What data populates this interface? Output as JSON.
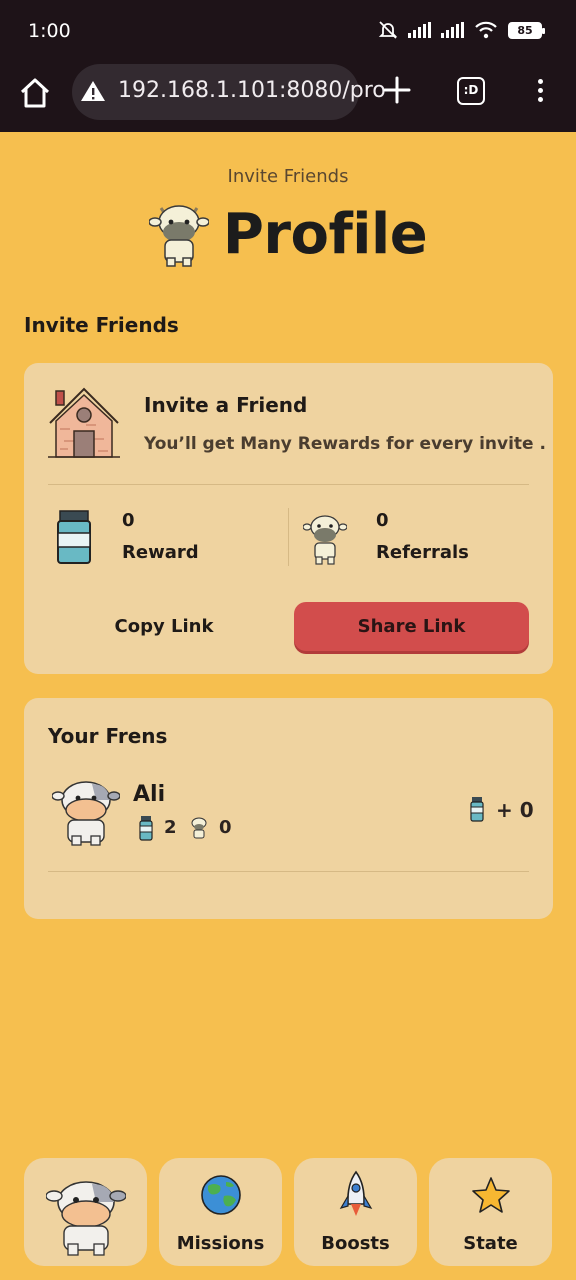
{
  "status_bar": {
    "time": "1:00",
    "battery": "85"
  },
  "browser": {
    "url": "192.168.1.101:8080/pro",
    "tabs_label": ":D"
  },
  "header": {
    "subtitle": "Invite Friends",
    "title": "Profile"
  },
  "section_heading": "Invite Friends",
  "invite": {
    "title": "Invite a Friend",
    "description": "You’ll get Many Rewards for every invite .",
    "reward_value": "0",
    "reward_label": "Reward",
    "referrals_value": "0",
    "referrals_label": "Referrals",
    "copy_label": "Copy Link",
    "share_label": "Share Link"
  },
  "frens": {
    "title": "Your Frens",
    "items": [
      {
        "name": "Ali",
        "milk": "2",
        "cows": "0",
        "reward": "+ 0"
      }
    ]
  },
  "nav": {
    "missions": "Missions",
    "boosts": "Boosts",
    "state": "State"
  },
  "colors": {
    "background": "#f6bf4f",
    "card": "#efd3a0",
    "accent_red": "#d24d4c",
    "system_bar": "#1e1318"
  },
  "icons": [
    "home-icon",
    "warning-icon",
    "plus-icon",
    "tabs-icon",
    "more-icon",
    "cow-icon",
    "house-icon",
    "milk-icon",
    "globe-icon",
    "rocket-icon",
    "star-icon"
  ]
}
